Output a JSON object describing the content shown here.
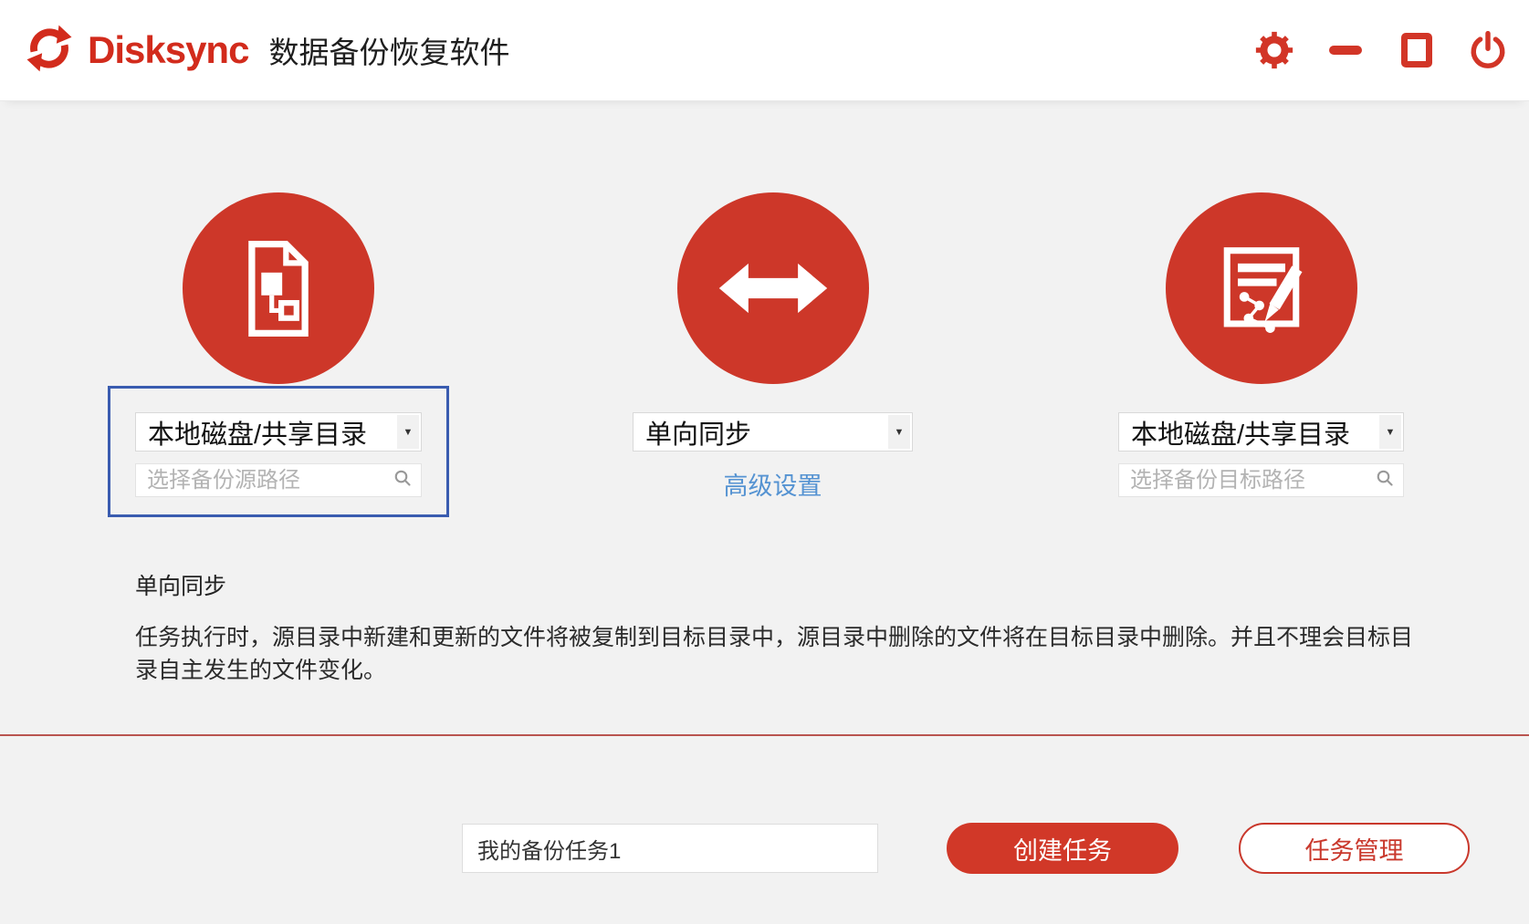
{
  "window": {
    "brand": "Disksync",
    "app_title": "数据备份恢复软件"
  },
  "source_panel": {
    "storage_type": "本地磁盘/共享目录",
    "path_placeholder": "选择备份源路径"
  },
  "sync_panel": {
    "mode": "单向同步",
    "advanced_link": "高级设置"
  },
  "target_panel": {
    "storage_type": "本地磁盘/共享目录",
    "path_placeholder": "选择备份目标路径"
  },
  "info": {
    "heading": "单向同步",
    "description": "任务执行时，源目录中新建和更新的文件将被复制到目标目录中，源目录中删除的文件将在目标目录中删除。并且不理会目标目录自主发生的文件变化。"
  },
  "footer": {
    "task_name": "我的备份任务1",
    "create_button": "创建任务",
    "manage_button": "任务管理"
  },
  "icons": {
    "dropdown_arrow": "▼"
  },
  "colors": {
    "accent_red": "#cf3528",
    "logo_red": "#d22b1c",
    "circle_red": "#cd3729",
    "link_blue": "#5593d2",
    "highlight_blue": "#3a5cb0",
    "divider_red": "#b95450",
    "background_gray": "#f2f2f2"
  }
}
